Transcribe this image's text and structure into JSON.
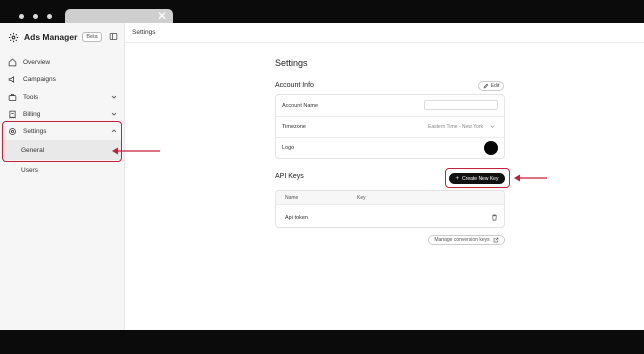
{
  "app": {
    "name": "Ads Manager",
    "badge": "Beta"
  },
  "sidebar": {
    "items": [
      {
        "label": "Overview",
        "icon": "home-icon"
      },
      {
        "label": "Campaigns",
        "icon": "megaphone-icon"
      },
      {
        "label": "Tools",
        "icon": "toolbox-icon",
        "chevron": "down"
      },
      {
        "label": "Billing",
        "icon": "billing-icon",
        "chevron": "down"
      },
      {
        "label": "Settings",
        "icon": "gear-icon",
        "chevron": "up",
        "expanded": true
      }
    ],
    "subitems": [
      {
        "label": "General",
        "active": true
      },
      {
        "label": "Users"
      }
    ]
  },
  "header": {
    "breadcrumb": "Settings"
  },
  "main": {
    "title": "Settings",
    "account_info": {
      "title": "Account Info",
      "edit_label": "Edit",
      "fields": [
        {
          "label": "Account Name",
          "value": ""
        },
        {
          "label": "Timezone",
          "value": "Eastern Time - New York"
        },
        {
          "label": "Logo"
        }
      ]
    },
    "api_keys": {
      "title": "API Keys",
      "create_label": "Create New Key",
      "columns": [
        "Name",
        "Key"
      ],
      "rows": [
        {
          "name": "Api token",
          "key": ""
        }
      ]
    },
    "manage_label": "Manage conversion keys"
  },
  "colors": {
    "highlight": "#c4203a",
    "primary_button": "#111111"
  }
}
